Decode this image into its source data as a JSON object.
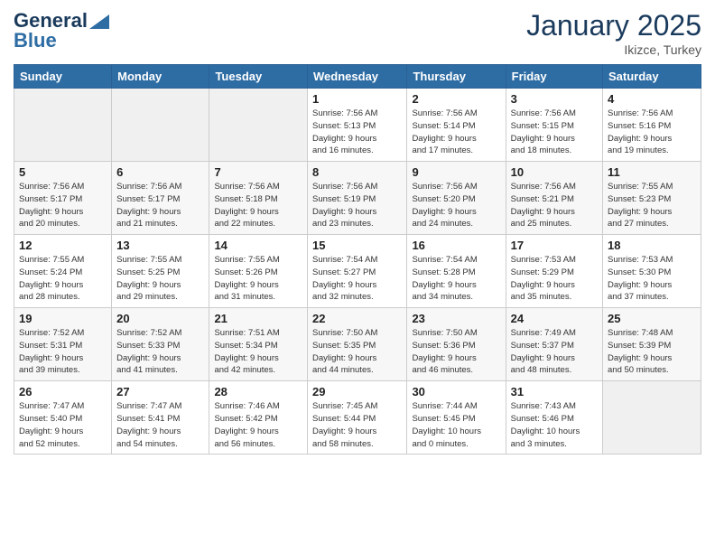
{
  "header": {
    "logo_general": "General",
    "logo_blue": "Blue",
    "month_title": "January 2025",
    "location": "Ikizce, Turkey"
  },
  "weekdays": [
    "Sunday",
    "Monday",
    "Tuesday",
    "Wednesday",
    "Thursday",
    "Friday",
    "Saturday"
  ],
  "weeks": [
    [
      {
        "day": "",
        "info": ""
      },
      {
        "day": "",
        "info": ""
      },
      {
        "day": "",
        "info": ""
      },
      {
        "day": "1",
        "info": "Sunrise: 7:56 AM\nSunset: 5:13 PM\nDaylight: 9 hours\nand 16 minutes."
      },
      {
        "day": "2",
        "info": "Sunrise: 7:56 AM\nSunset: 5:14 PM\nDaylight: 9 hours\nand 17 minutes."
      },
      {
        "day": "3",
        "info": "Sunrise: 7:56 AM\nSunset: 5:15 PM\nDaylight: 9 hours\nand 18 minutes."
      },
      {
        "day": "4",
        "info": "Sunrise: 7:56 AM\nSunset: 5:16 PM\nDaylight: 9 hours\nand 19 minutes."
      }
    ],
    [
      {
        "day": "5",
        "info": "Sunrise: 7:56 AM\nSunset: 5:17 PM\nDaylight: 9 hours\nand 20 minutes."
      },
      {
        "day": "6",
        "info": "Sunrise: 7:56 AM\nSunset: 5:17 PM\nDaylight: 9 hours\nand 21 minutes."
      },
      {
        "day": "7",
        "info": "Sunrise: 7:56 AM\nSunset: 5:18 PM\nDaylight: 9 hours\nand 22 minutes."
      },
      {
        "day": "8",
        "info": "Sunrise: 7:56 AM\nSunset: 5:19 PM\nDaylight: 9 hours\nand 23 minutes."
      },
      {
        "day": "9",
        "info": "Sunrise: 7:56 AM\nSunset: 5:20 PM\nDaylight: 9 hours\nand 24 minutes."
      },
      {
        "day": "10",
        "info": "Sunrise: 7:56 AM\nSunset: 5:21 PM\nDaylight: 9 hours\nand 25 minutes."
      },
      {
        "day": "11",
        "info": "Sunrise: 7:55 AM\nSunset: 5:23 PM\nDaylight: 9 hours\nand 27 minutes."
      }
    ],
    [
      {
        "day": "12",
        "info": "Sunrise: 7:55 AM\nSunset: 5:24 PM\nDaylight: 9 hours\nand 28 minutes."
      },
      {
        "day": "13",
        "info": "Sunrise: 7:55 AM\nSunset: 5:25 PM\nDaylight: 9 hours\nand 29 minutes."
      },
      {
        "day": "14",
        "info": "Sunrise: 7:55 AM\nSunset: 5:26 PM\nDaylight: 9 hours\nand 31 minutes."
      },
      {
        "day": "15",
        "info": "Sunrise: 7:54 AM\nSunset: 5:27 PM\nDaylight: 9 hours\nand 32 minutes."
      },
      {
        "day": "16",
        "info": "Sunrise: 7:54 AM\nSunset: 5:28 PM\nDaylight: 9 hours\nand 34 minutes."
      },
      {
        "day": "17",
        "info": "Sunrise: 7:53 AM\nSunset: 5:29 PM\nDaylight: 9 hours\nand 35 minutes."
      },
      {
        "day": "18",
        "info": "Sunrise: 7:53 AM\nSunset: 5:30 PM\nDaylight: 9 hours\nand 37 minutes."
      }
    ],
    [
      {
        "day": "19",
        "info": "Sunrise: 7:52 AM\nSunset: 5:31 PM\nDaylight: 9 hours\nand 39 minutes."
      },
      {
        "day": "20",
        "info": "Sunrise: 7:52 AM\nSunset: 5:33 PM\nDaylight: 9 hours\nand 41 minutes."
      },
      {
        "day": "21",
        "info": "Sunrise: 7:51 AM\nSunset: 5:34 PM\nDaylight: 9 hours\nand 42 minutes."
      },
      {
        "day": "22",
        "info": "Sunrise: 7:50 AM\nSunset: 5:35 PM\nDaylight: 9 hours\nand 44 minutes."
      },
      {
        "day": "23",
        "info": "Sunrise: 7:50 AM\nSunset: 5:36 PM\nDaylight: 9 hours\nand 46 minutes."
      },
      {
        "day": "24",
        "info": "Sunrise: 7:49 AM\nSunset: 5:37 PM\nDaylight: 9 hours\nand 48 minutes."
      },
      {
        "day": "25",
        "info": "Sunrise: 7:48 AM\nSunset: 5:39 PM\nDaylight: 9 hours\nand 50 minutes."
      }
    ],
    [
      {
        "day": "26",
        "info": "Sunrise: 7:47 AM\nSunset: 5:40 PM\nDaylight: 9 hours\nand 52 minutes."
      },
      {
        "day": "27",
        "info": "Sunrise: 7:47 AM\nSunset: 5:41 PM\nDaylight: 9 hours\nand 54 minutes."
      },
      {
        "day": "28",
        "info": "Sunrise: 7:46 AM\nSunset: 5:42 PM\nDaylight: 9 hours\nand 56 minutes."
      },
      {
        "day": "29",
        "info": "Sunrise: 7:45 AM\nSunset: 5:44 PM\nDaylight: 9 hours\nand 58 minutes."
      },
      {
        "day": "30",
        "info": "Sunrise: 7:44 AM\nSunset: 5:45 PM\nDaylight: 10 hours\nand 0 minutes."
      },
      {
        "day": "31",
        "info": "Sunrise: 7:43 AM\nSunset: 5:46 PM\nDaylight: 10 hours\nand 3 minutes."
      },
      {
        "day": "",
        "info": ""
      }
    ]
  ]
}
